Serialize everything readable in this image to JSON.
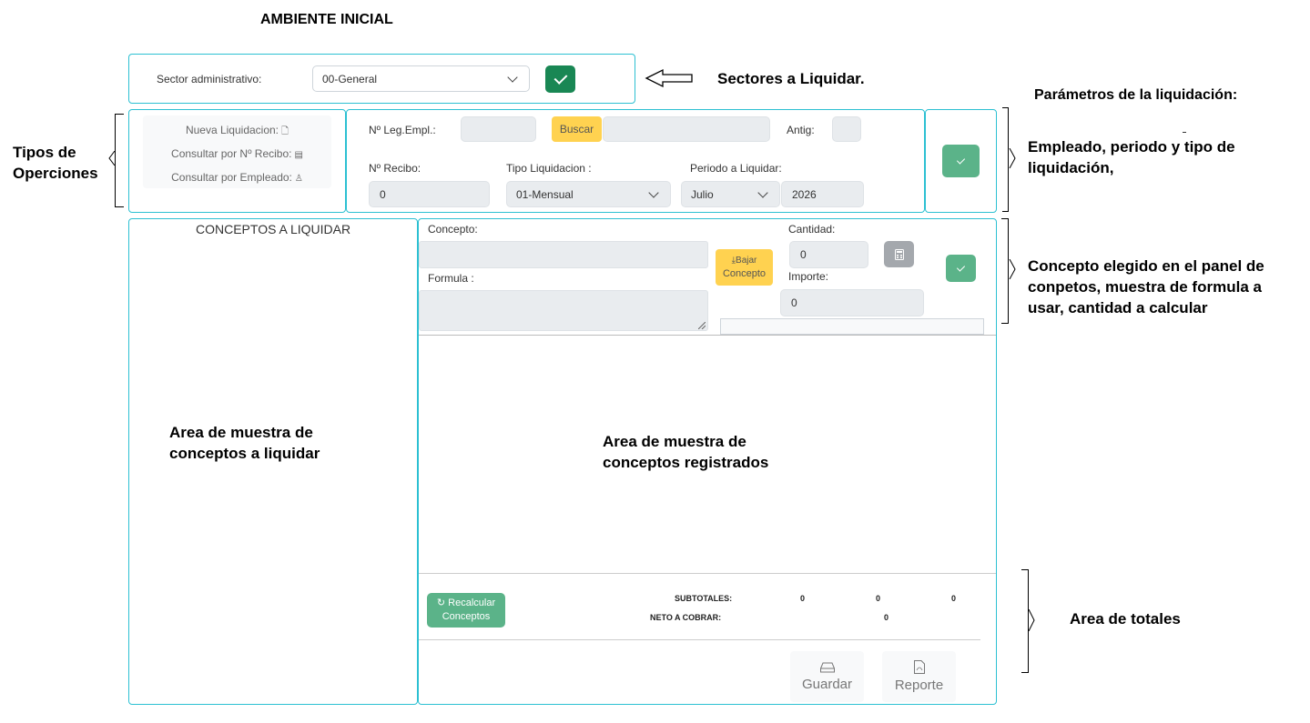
{
  "page_title": "AMBIENTE INICIAL",
  "sector": {
    "label": "Sector administrativo:",
    "selected": "00-General"
  },
  "annotations": {
    "sectores": "Sectores a Liquidar.",
    "parametros_title": "Parámetros de la liquidación:",
    "parametros_body": "Empleado, periodo y tipo de liquidación,",
    "tipos": "Tipos de Operciones",
    "concepto_elegido": "Concepto elegido en el panel de conpetos, muestra de formula a usar, cantidad a calcular",
    "area_conceptos": "Area de muestra de conceptos a liquidar",
    "area_registrados": "Area de muestra de conceptos registrados",
    "area_totales": "Area de totales"
  },
  "operaciones": {
    "items": [
      {
        "label": "Nueva Liquidacion:",
        "icon": "file-plus-icon"
      },
      {
        "label": "Consultar por Nº Recibo:",
        "icon": "receipt-icon"
      },
      {
        "label": "Consultar por Empleado:",
        "icon": "person-icon"
      }
    ]
  },
  "params": {
    "leg_label": "Nº Leg.Empl.:",
    "leg_value": "",
    "buscar_label": "Buscar",
    "employee_name": "",
    "antig_label": "Antig:",
    "antig_value": "",
    "recibo_label": "Nº Recibo:",
    "recibo_value": "0",
    "tipo_label": "Tipo Liquidacion :",
    "tipo_selected": "01-Mensual",
    "periodo_label": "Periodo a Liquidar:",
    "periodo_month": "Julio",
    "periodo_year": "2026"
  },
  "conceptos_panel": {
    "title": "CONCEPTOS A LIQUIDAR"
  },
  "concepto": {
    "concepto_label": "Concepto:",
    "concepto_value": "",
    "formula_label": "Formula :",
    "formula_value": "",
    "bajar_label_1": "Bajar",
    "bajar_label_2": "Concepto",
    "cantidad_label": "Cantidad:",
    "cantidad_value": "0",
    "importe_label": "Importe:",
    "importe_value": "0"
  },
  "totales": {
    "recalcular_1": "Recalcular",
    "recalcular_2": "Conceptos",
    "subtotales_label": "SUBTOTALES:",
    "subtotal_1": "0",
    "subtotal_2": "0",
    "subtotal_3": "0",
    "neto_label": "NETO A COBRAR:",
    "neto_value": "0"
  },
  "footer": {
    "guardar": "Guardar",
    "reporte": "Reporte"
  },
  "colors": {
    "border": "#2cc0d2",
    "green_primary": "#198754",
    "green_light": "#5bb389",
    "yellow": "#ffd250",
    "field_bg": "#e9ecef"
  }
}
